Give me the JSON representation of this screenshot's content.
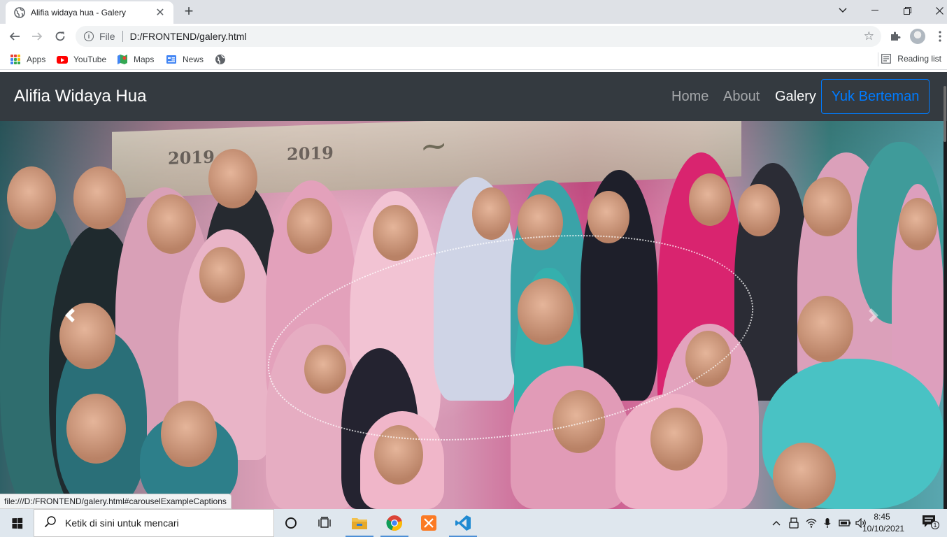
{
  "browser": {
    "tab_title": "Alifia widaya hua - Galery",
    "url_scheme_label": "File",
    "url": "D:/FRONTEND/galery.html",
    "bookmarks": [
      "Apps",
      "YouTube",
      "Maps",
      "News"
    ],
    "reading_list_label": "Reading list",
    "status_link": "file:///D:/FRONTEND/galery.html#carouselExampleCaptions"
  },
  "site": {
    "brand": "Alifia Widaya Hua",
    "nav": {
      "home": "Home",
      "about": "About",
      "galery": "Galery",
      "cta": "Yuk Berteman"
    },
    "colors": {
      "navbar_bg": "#343a40",
      "primary": "#007bff"
    }
  },
  "carousel": {
    "banner_texts": [
      "2019",
      "2019"
    ],
    "controls": {
      "prev_icon": "chevron-left-icon",
      "next_icon": "chevron-right-icon"
    }
  },
  "taskbar": {
    "search_placeholder": "Ketik di sini untuk mencari",
    "time": "8:45",
    "date": "10/10/2021",
    "notification_count": "1"
  }
}
